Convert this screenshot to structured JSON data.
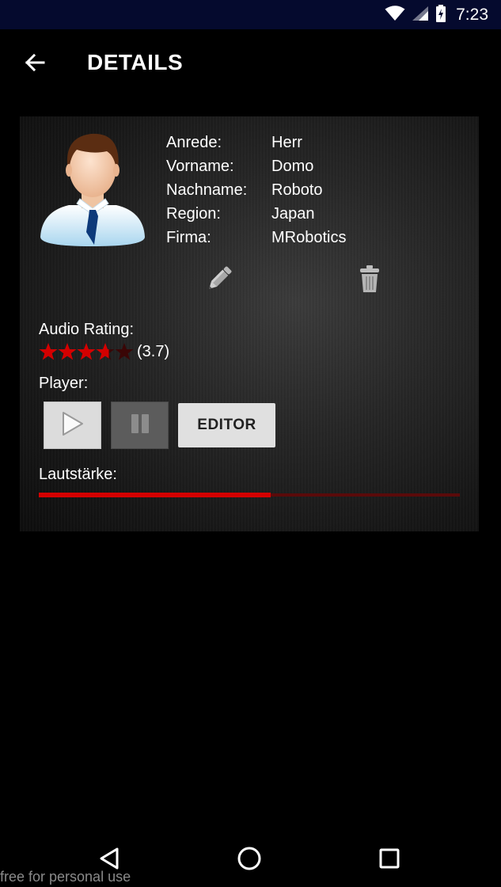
{
  "status_bar": {
    "time": "7:23",
    "icons": [
      "wifi-icon",
      "cellular-signal-icon",
      "battery-charging-icon"
    ]
  },
  "app_bar": {
    "title": "DETAILS",
    "back_icon": "arrow-back-icon"
  },
  "profile": {
    "avatar_icon": "businessman-avatar",
    "fields": [
      {
        "label": "Anrede:",
        "value": "Herr"
      },
      {
        "label": "Vorname:",
        "value": "Domo"
      },
      {
        "label": "Nachname:",
        "value": "Roboto"
      },
      {
        "label": "Region:",
        "value": "Japan"
      },
      {
        "label": "Firma:",
        "value": "MRobotics"
      }
    ],
    "edit_icon": "pencil-icon",
    "delete_icon": "trash-icon"
  },
  "rating": {
    "label": "Audio Rating:",
    "stars_max": 5,
    "stars_value": 3.7,
    "value_text": "(3.7)"
  },
  "player": {
    "label": "Player:",
    "play_icon": "play-icon",
    "pause_icon": "pause-icon",
    "editor_label": "EDITOR"
  },
  "volume": {
    "label": "Lautstärke:",
    "level": 0.55
  },
  "nav": {
    "back_icon": "nav-back-icon",
    "home_icon": "nav-home-icon",
    "recents_icon": "nav-recents-icon"
  },
  "watermark": "free for personal use",
  "colors": {
    "status_bar": "#050a2e",
    "accent_red": "#d40000",
    "track_dark_red": "#5a0a0a",
    "button_light": "#dcdcdc",
    "button_disabled": "#5c5c5c"
  }
}
